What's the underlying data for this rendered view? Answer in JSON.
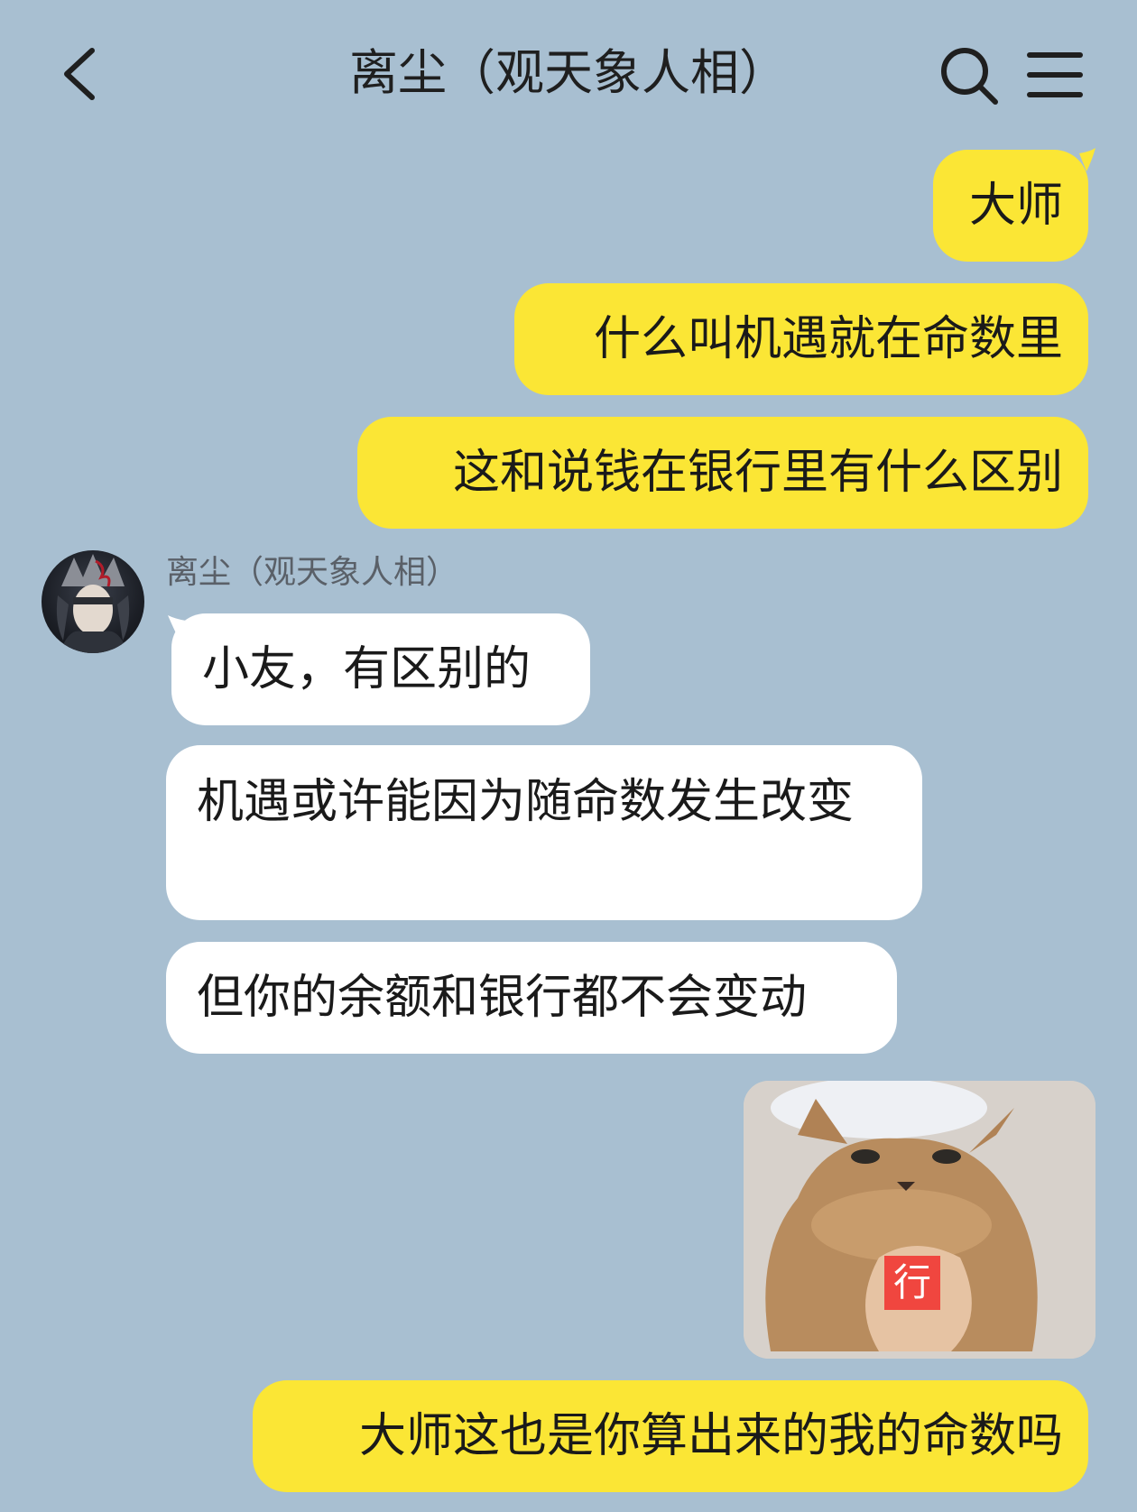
{
  "header": {
    "title": "离尘（观天象人相）",
    "back_icon": "chevron-left-icon",
    "search_icon": "search-icon",
    "menu_icon": "hamburger-menu-icon"
  },
  "contact": {
    "name": "离尘（观天象人相）"
  },
  "messages": {
    "m1": "大师",
    "m2": "什么叫机遇就在命数里",
    "m3": "这和说钱在银行里有什么区别",
    "m4": "小友，有区别的",
    "m5": "机遇或许能因为随命数发生改变",
    "m6": "但你的余额和银行都不会变动",
    "sticker_text": "行",
    "m7": "大师这也是你算出来的我的命数吗"
  },
  "colors": {
    "background": "#a8bfd1",
    "outgoing_bubble": "#fbe635",
    "incoming_bubble": "#ffffff",
    "sticker_badge": "#f0463f"
  }
}
